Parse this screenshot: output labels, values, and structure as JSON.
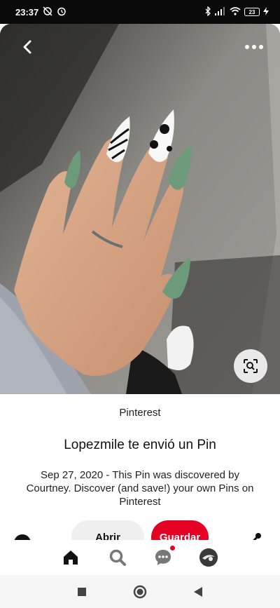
{
  "status_bar": {
    "time": "23:37",
    "battery_level": "23",
    "icons": [
      "alarm-off-icon",
      "alarm-icon",
      "bluetooth-icon",
      "signal-icon",
      "wifi-icon",
      "battery-icon",
      "charging-icon"
    ]
  },
  "pin": {
    "source": "Pinterest",
    "title": "Lopezmile te envió un Pin",
    "description": "Sep 27, 2020 - This Pin was discovered by Courtney. Discover (and save!) your own Pins on Pinterest"
  },
  "actions": {
    "open_label": "Abrir",
    "save_label": "Guardar"
  },
  "bottom_nav": [
    "home-icon",
    "search-icon",
    "messages-icon",
    "profile-avatar"
  ],
  "colors": {
    "brand_red": "#e60023",
    "status_bar_bg": "#0a0a0a",
    "nail_green": "#6e9a7c"
  }
}
